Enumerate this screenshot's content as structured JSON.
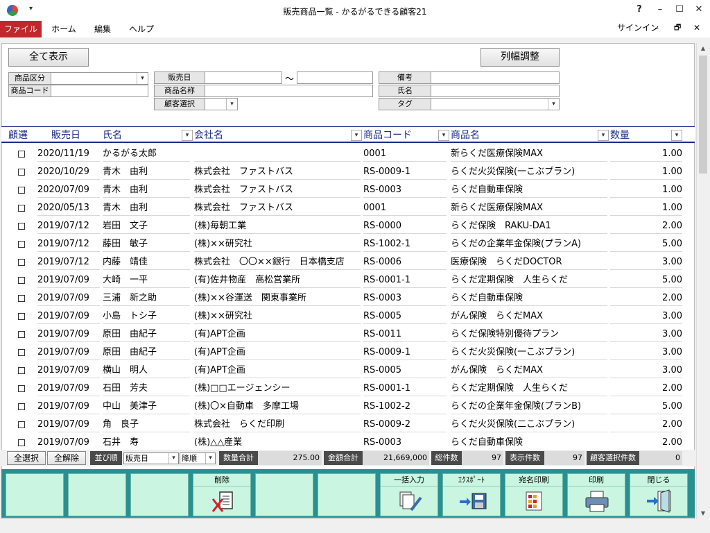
{
  "window": {
    "title": "販売商品一覧 - かるがるできる顧客21",
    "help": "?",
    "minimize": "–",
    "maximize": "☐",
    "close": "✕"
  },
  "menu": {
    "file": "ファイル",
    "home": "ホーム",
    "edit": "編集",
    "help": "ヘルプ",
    "signin": "サインイン",
    "restore": "🗗"
  },
  "toolbar": {
    "show_all": "全て表示",
    "column_width": "列幅調整"
  },
  "filters": {
    "category_label": "商品区分",
    "code_label": "商品コード",
    "sale_date_label": "販売日",
    "tilde": "～",
    "product_name_label": "商品名称",
    "customer_select_label": "顧客選択",
    "note_label": "備考",
    "name_label": "氏名",
    "tag_label": "タグ"
  },
  "columns": {
    "select": "顧選",
    "date": "販売日",
    "name": "氏名",
    "company": "会社名",
    "code": "商品コード",
    "product": "商品名",
    "qty": "数量"
  },
  "rows": [
    {
      "date": "2020/11/19",
      "name": "かるがる太郎",
      "company": "",
      "code": "0001",
      "product": "新らくだ医療保険MAX",
      "qty": "1.00"
    },
    {
      "date": "2020/10/29",
      "name": "青木　由利",
      "company": "株式会社　ファストバス",
      "code": "RS-0009-1",
      "product": "らくだ火災保険(一こぶプラン)",
      "qty": "1.00"
    },
    {
      "date": "2020/07/09",
      "name": "青木　由利",
      "company": "株式会社　ファストバス",
      "code": "RS-0003",
      "product": "らくだ自動車保険",
      "qty": "1.00"
    },
    {
      "date": "2020/05/13",
      "name": "青木　由利",
      "company": "株式会社　ファストバス",
      "code": "0001",
      "product": "新らくだ医療保険MAX",
      "qty": "1.00"
    },
    {
      "date": "2019/07/12",
      "name": "岩田　文子",
      "company": "(株)毎朝工業",
      "code": "RS-0000",
      "product": "らくだ保険　RAKU-DA1",
      "qty": "2.00"
    },
    {
      "date": "2019/07/12",
      "name": "藤田　敏子",
      "company": "(株)××研究社",
      "code": "RS-1002-1",
      "product": "らくだの企業年金保険(プランA)",
      "qty": "5.00"
    },
    {
      "date": "2019/07/12",
      "name": "内藤　靖佳",
      "company": "株式会社　〇〇××銀行　日本橋支店",
      "code": "RS-0006",
      "product": "医療保険　らくだDOCTOR",
      "qty": "3.00"
    },
    {
      "date": "2019/07/09",
      "name": "大崎　一平",
      "company": "(有)佐井物産　高松営業所",
      "code": "RS-0001-1",
      "product": "らくだ定期保険　人生らくだ",
      "qty": "5.00"
    },
    {
      "date": "2019/07/09",
      "name": "三浦　新之助",
      "company": "(株)××谷運送　関東事業所",
      "code": "RS-0003",
      "product": "らくだ自動車保険",
      "qty": "2.00"
    },
    {
      "date": "2019/07/09",
      "name": "小島　トシ子",
      "company": "(株)××研究社",
      "code": "RS-0005",
      "product": "がん保険　らくだMAX",
      "qty": "3.00"
    },
    {
      "date": "2019/07/09",
      "name": "原田　由紀子",
      "company": "(有)APT企画",
      "code": "RS-0011",
      "product": "らくだ保険特別優待プラン",
      "qty": "3.00"
    },
    {
      "date": "2019/07/09",
      "name": "原田　由紀子",
      "company": "(有)APT企画",
      "code": "RS-0009-1",
      "product": "らくだ火災保険(一こぶプラン)",
      "qty": "3.00"
    },
    {
      "date": "2019/07/09",
      "name": "横山　明人",
      "company": "(有)APT企画",
      "code": "RS-0005",
      "product": "がん保険　らくだMAX",
      "qty": "3.00"
    },
    {
      "date": "2019/07/09",
      "name": "石田　芳夫",
      "company": "(株)□□エージェンシー",
      "code": "RS-0001-1",
      "product": "らくだ定期保険　人生らくだ",
      "qty": "2.00"
    },
    {
      "date": "2019/07/09",
      "name": "中山　美津子",
      "company": "(株)〇×自動車　多摩工場",
      "code": "RS-1002-2",
      "product": "らくだの企業年金保険(プランB)",
      "qty": "5.00"
    },
    {
      "date": "2019/07/09",
      "name": "角　良子",
      "company": "株式会社　らくだ印刷",
      "code": "RS-0009-2",
      "product": "らくだ火災保険(二こぶプラン)",
      "qty": "2.00"
    },
    {
      "date": "2019/07/09",
      "name": "石井　寿",
      "company": "(株)△△産業",
      "code": "RS-0003",
      "product": "らくだ自動車保険",
      "qty": "2.00"
    }
  ],
  "status": {
    "select_all": "全選択",
    "deselect_all": "全解除",
    "sort_label": "並び順",
    "sort_field": "販売日",
    "sort_order": "降順",
    "qty_total_label": "数量合計",
    "qty_total": "275.00",
    "amount_total_label": "金額合計",
    "amount_total": "21,669,000",
    "total_count_label": "総件数",
    "total_count": "97",
    "display_count_label": "表示件数",
    "display_count": "97",
    "customer_select_count_label": "顧客選択件数",
    "customer_select_count": "0"
  },
  "fkeys": {
    "delete": "削除",
    "bulk_input": "一括入力",
    "export": "ｴｸｽﾎﾟｰﾄ",
    "address_print": "宛名印刷",
    "print": "印刷",
    "close": "閉じる"
  }
}
